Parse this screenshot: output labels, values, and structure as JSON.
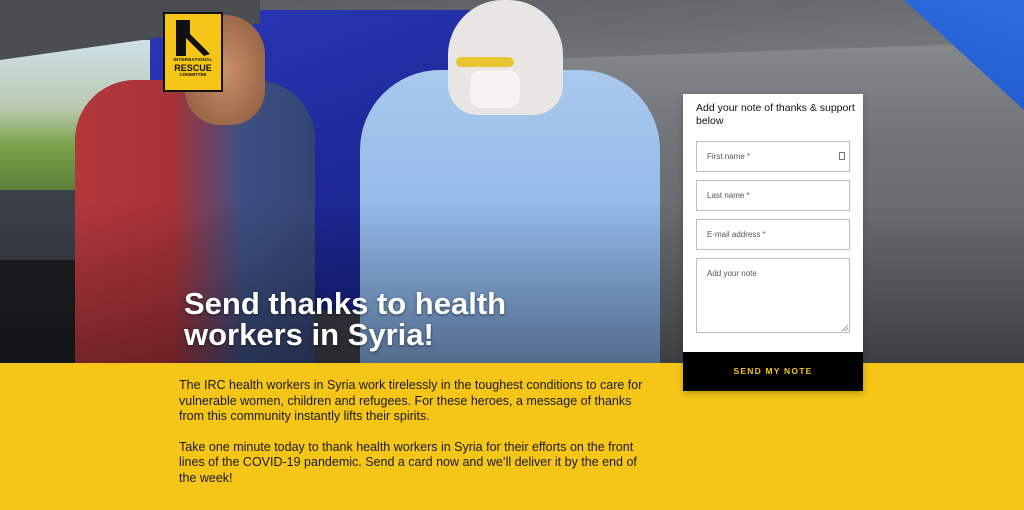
{
  "brand": {
    "logo_line1": "INTERNATIONAL",
    "logo_line2": "RESCUE",
    "logo_line3": "COMMITTEE",
    "accent_color": "#f5c518"
  },
  "hero": {
    "headline": "Send thanks to health workers in Syria!"
  },
  "body": {
    "paragraph1": "The IRC health workers in Syria work tirelessly in the toughest conditions to care for vulnerable women, children and refugees. For these heroes, a message of thanks from this community instantly lifts their spirits.",
    "paragraph2": "Take one minute today to thank health workers in Syria for their efforts on the front lines of the COVID-19 pandemic. Send a card now and we’ll deliver it by the end of the week!"
  },
  "form": {
    "title": "Add your note of thanks & support below",
    "first_name_placeholder": "First name",
    "last_name_placeholder": "Last name",
    "email_placeholder": "E-mail address",
    "note_placeholder": "Add your note",
    "required_marker": "*",
    "submit_label": "SEND MY NOTE"
  },
  "icons": {
    "autofill": "contact-card-icon",
    "resize": "resize-grip-icon"
  }
}
